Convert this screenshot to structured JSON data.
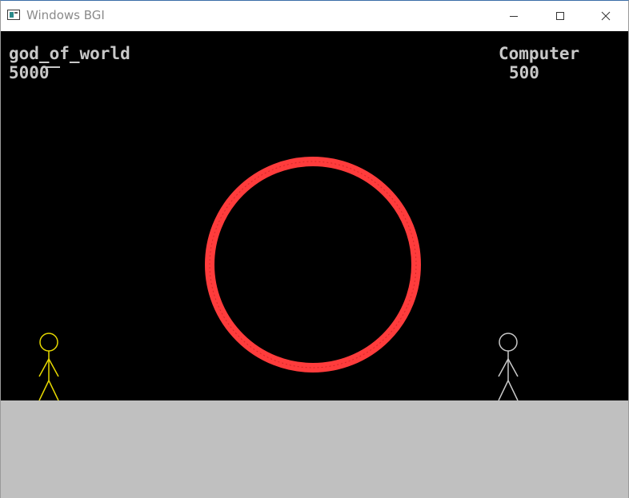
{
  "window": {
    "title": "Windows BGI",
    "controls": [
      "minimize-icon",
      "maximize-icon",
      "close-icon"
    ]
  },
  "game": {
    "player": {
      "name": "god_of_world",
      "score": "5000",
      "color": "#e6d800"
    },
    "opponent": {
      "name": "Computer",
      "score": "500",
      "color": "#c8c8c8"
    },
    "ring_color": "#ff3c3c",
    "background": "#000000",
    "ground_color": "#c0c0c0",
    "hud_color": "#c8c8c8"
  }
}
